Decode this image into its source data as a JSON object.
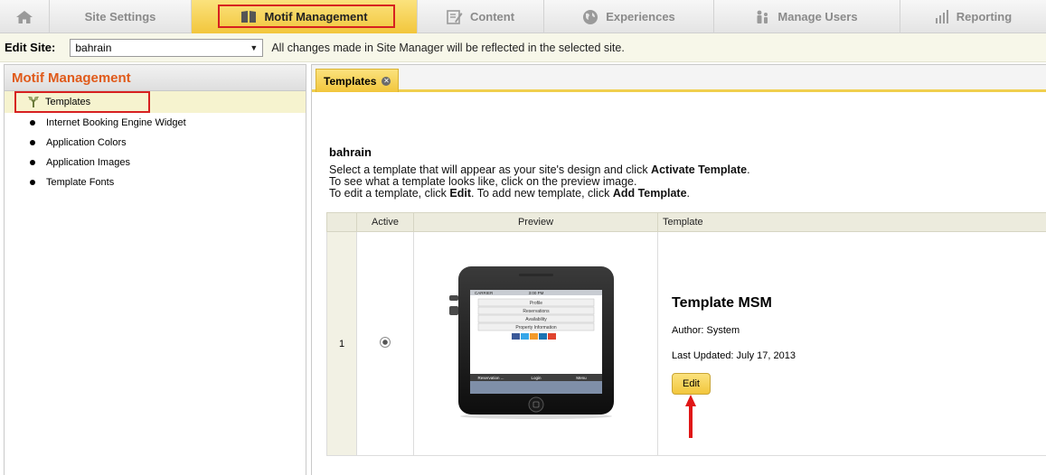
{
  "nav": {
    "tabs": [
      {
        "label": "Site Settings"
      },
      {
        "label": "Motif Management"
      },
      {
        "label": "Content"
      },
      {
        "label": "Experiences"
      },
      {
        "label": "Manage Users"
      },
      {
        "label": "Reporting"
      }
    ]
  },
  "sitebar": {
    "label": "Edit Site:",
    "selected_site": "bahrain",
    "note": "All changes made in Site Manager will be reflected in the selected site."
  },
  "left": {
    "title": "Motif Management",
    "selected_item": "Templates",
    "items": [
      {
        "label": "Internet Booking Engine Widget"
      },
      {
        "label": "Application Colors"
      },
      {
        "label": "Application Images"
      },
      {
        "label": "Template Fonts"
      }
    ]
  },
  "right": {
    "tab_label": "Templates",
    "site_name": "bahrain",
    "instructions": {
      "line1_pre": "Select a template that will appear as your site's design and click ",
      "line1_bold": "Activate Template",
      "line1_post": ".",
      "line2": "To see what a template looks like, click on the preview image.",
      "line3_pre": "To edit a template, click ",
      "line3_bold1": "Edit",
      "line3_mid": ". To add new template, click ",
      "line3_bold2": "Add Template",
      "line3_post": "."
    },
    "table": {
      "headers": {
        "num": "",
        "active": "Active",
        "preview": "Preview",
        "template": "Template"
      },
      "rows": [
        {
          "num": "1",
          "template_name": "Template MSM",
          "author": "Author: System",
          "last_updated": "Last Updated: July 17, 2013",
          "edit_label": "Edit"
        }
      ]
    },
    "phone_preview": {
      "carrier": "CARRIER",
      "time": "3:00 PM",
      "menu": [
        "Profile",
        "Reservations",
        "Availability",
        "Property Information"
      ],
      "bottom": [
        "Reservation ...",
        "Login",
        "Menu"
      ]
    }
  },
  "colors": {
    "accent_yellow": "#f2c63c",
    "highlight_red": "#d72020",
    "title_orange": "#e05a1a"
  }
}
